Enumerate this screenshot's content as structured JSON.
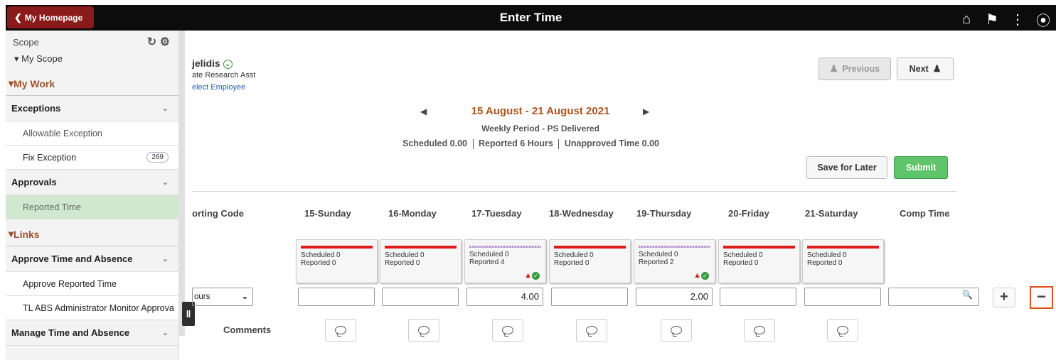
{
  "header": {
    "home_label": "My Homepage",
    "title": "Enter Time",
    "icons": [
      "home-icon",
      "flag-icon",
      "more-icon",
      "compass-icon"
    ]
  },
  "sidebar": {
    "scope_label": "Scope",
    "my_scope": "My Scope",
    "sections": {
      "my_work": "My Work",
      "links": "Links"
    },
    "groups": {
      "exceptions": "Exceptions",
      "approvals": "Approvals",
      "approve_time": "Approve Time and Absence",
      "manage_time": "Manage Time and Absence"
    },
    "items": {
      "allowable_exception": "Allowable Exception",
      "fix_exception": "Fix Exception",
      "fix_exception_count": "269",
      "reported_time": "Reported Time",
      "approve_reported_time": "Approve Reported Time",
      "tl_abs_monitor": "TL ABS Administrator Monitor Approva"
    }
  },
  "employee": {
    "name": "jelidis",
    "title": "ate Research Asst",
    "select_link": "elect Employee"
  },
  "nav": {
    "previous_label": "Previous",
    "next_label": "Next"
  },
  "period": {
    "date_range": "15 August - 21 August 2021",
    "type": "Weekly Period - PS Delivered",
    "scheduled": "Scheduled  0.00",
    "reported": "Reported  6 Hours",
    "unapproved": "Unapproved Time  0.00"
  },
  "actions": {
    "save_label": "Save for Later",
    "submit_label": "Submit"
  },
  "grid": {
    "reporting_code_header": "orting Code",
    "comp_time_header": "Comp Time",
    "trc_value": "ours",
    "comments_label": "Comments",
    "days": [
      {
        "label": "15-Sunday",
        "scheduled": "Scheduled 0",
        "reported": "Reported  0",
        "hours": ""
      },
      {
        "label": "16-Monday",
        "scheduled": "Scheduled 0",
        "reported": "Reported  0",
        "hours": ""
      },
      {
        "label": "17-Tuesday",
        "scheduled": "Scheduled 0",
        "reported": "Reported  4",
        "hours": "4.00"
      },
      {
        "label": "18-Wednesday",
        "scheduled": "Scheduled 0",
        "reported": "Reported  0",
        "hours": ""
      },
      {
        "label": "19-Thursday",
        "scheduled": "Scheduled 0",
        "reported": "Reported  2",
        "hours": "2.00"
      },
      {
        "label": "20-Friday",
        "scheduled": "Scheduled 0",
        "reported": "Reported  0",
        "hours": ""
      },
      {
        "label": "21-Saturday",
        "scheduled": "Scheduled 0",
        "reported": "Reported  0",
        "hours": ""
      }
    ]
  }
}
